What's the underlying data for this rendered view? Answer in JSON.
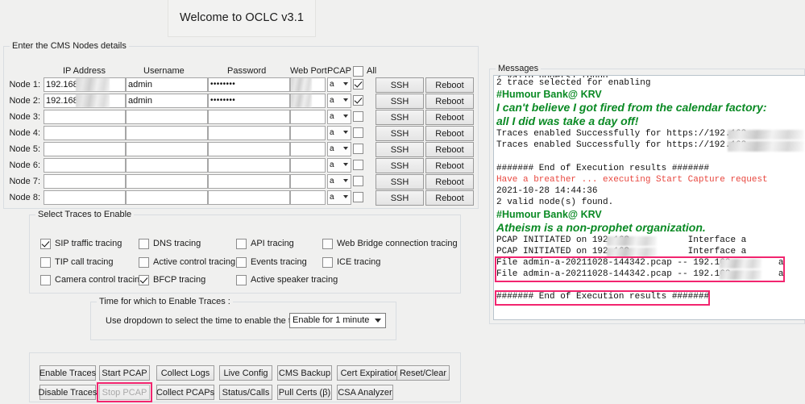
{
  "window": {
    "title": "Welcome to OCLC v3.1"
  },
  "nodes_panel": {
    "legend": "Enter the CMS Nodes details",
    "columns": {
      "ip": "IP Address",
      "username": "Username",
      "password": "Password",
      "webport": "Web Port",
      "pcap": "PCAP",
      "all": "All"
    },
    "all_checked": false,
    "rows": [
      {
        "label": "Node 1:",
        "ip": "192.168",
        "username": "admin",
        "password": "••••••••",
        "webport": "",
        "pcap_mode": "a",
        "pcap_checked": true,
        "ssh": "SSH",
        "reboot": "Reboot",
        "redacted": true
      },
      {
        "label": "Node 2:",
        "ip": "192.168",
        "username": "admin",
        "password": "••••••••",
        "webport": "",
        "pcap_mode": "a",
        "pcap_checked": true,
        "ssh": "SSH",
        "reboot": "Reboot",
        "redacted": true
      },
      {
        "label": "Node 3:",
        "ip": "",
        "username": "",
        "password": "",
        "webport": "",
        "pcap_mode": "a",
        "pcap_checked": false,
        "ssh": "SSH",
        "reboot": "Reboot",
        "redacted": false
      },
      {
        "label": "Node 4:",
        "ip": "",
        "username": "",
        "password": "",
        "webport": "",
        "pcap_mode": "a",
        "pcap_checked": false,
        "ssh": "SSH",
        "reboot": "Reboot",
        "redacted": false
      },
      {
        "label": "Node 5:",
        "ip": "",
        "username": "",
        "password": "",
        "webport": "",
        "pcap_mode": "a",
        "pcap_checked": false,
        "ssh": "SSH",
        "reboot": "Reboot",
        "redacted": false
      },
      {
        "label": "Node 6:",
        "ip": "",
        "username": "",
        "password": "",
        "webport": "",
        "pcap_mode": "a",
        "pcap_checked": false,
        "ssh": "SSH",
        "reboot": "Reboot",
        "redacted": false
      },
      {
        "label": "Node 7:",
        "ip": "",
        "username": "",
        "password": "",
        "webport": "",
        "pcap_mode": "a",
        "pcap_checked": false,
        "ssh": "SSH",
        "reboot": "Reboot",
        "redacted": false
      },
      {
        "label": "Node 8:",
        "ip": "",
        "username": "",
        "password": "",
        "webport": "",
        "pcap_mode": "a",
        "pcap_checked": false,
        "ssh": "SSH",
        "reboot": "Reboot",
        "redacted": false
      }
    ]
  },
  "traces_panel": {
    "legend": "Select Traces to Enable",
    "items": [
      {
        "label": "SIP traffic tracing",
        "checked": true,
        "col": 0,
        "row": 0
      },
      {
        "label": "DNS tracing",
        "checked": false,
        "col": 1,
        "row": 0
      },
      {
        "label": "API tracing",
        "checked": false,
        "col": 2,
        "row": 0
      },
      {
        "label": "Web Bridge connection tracing",
        "checked": false,
        "col": 3,
        "row": 0
      },
      {
        "label": "TIP call tracing",
        "checked": false,
        "col": 0,
        "row": 1
      },
      {
        "label": "Active control tracing",
        "checked": false,
        "col": 1,
        "row": 1
      },
      {
        "label": "Events tracing",
        "checked": false,
        "col": 2,
        "row": 1
      },
      {
        "label": "ICE tracing",
        "checked": false,
        "col": 3,
        "row": 1
      },
      {
        "label": "Camera control tracing",
        "checked": false,
        "col": 0,
        "row": 2
      },
      {
        "label": "BFCP tracing",
        "checked": true,
        "col": 1,
        "row": 2
      },
      {
        "label": "Active speaker tracing",
        "checked": false,
        "col": 2,
        "row": 2
      }
    ]
  },
  "time_panel": {
    "legend": "Time for which to Enable Traces :",
    "prompt": "Use dropdown to select the time to enable the traces:",
    "selected": "Enable for 1 minute"
  },
  "actions_panel": {
    "row1": [
      "Enable  Traces",
      "Start PCAP",
      "Collect  Logs",
      "Live Config",
      "CMS Backup",
      "Cert Expiration",
      "Reset/Clear"
    ],
    "row2": [
      "Disable Traces",
      "Stop PCAP",
      "Collect PCAPs",
      "Status/Calls",
      "Pull Certs (β)",
      "CSA Analyzer"
    ],
    "disabled_button": "Stop PCAP",
    "highlight_color": "#f2256f"
  },
  "messages_panel": {
    "legend": "Messages",
    "lines": [
      {
        "text": "2 valid node(s) found.",
        "style": "clipped"
      },
      {
        "text": "2 trace selected for enabling",
        "style": "mono"
      },
      {
        "text": "#Humour Bank@ KRV",
        "style": "green-heading"
      },
      {
        "text": "I can't believe I got fired from the calendar factory:",
        "style": "green-italic"
      },
      {
        "text": "all I did was take a day off!",
        "style": "green-italic"
      },
      {
        "text": "Traces enabled Successfully for https://192.168.",
        "style": "mono",
        "redacted": true
      },
      {
        "text": "Traces enabled Successfully for https://192.168.",
        "style": "mono",
        "redacted": true
      },
      {
        "text": "",
        "style": "blank"
      },
      {
        "text": "####### End of Execution results #######",
        "style": "mono"
      },
      {
        "text": "Have a breather ... executing Start Capture request",
        "style": "red"
      },
      {
        "text": "2021-10-28 14:44:36",
        "style": "mono"
      },
      {
        "text": "2 valid node(s) found.",
        "style": "mono"
      },
      {
        "text": "#Humour Bank@ KRV",
        "style": "green-heading"
      },
      {
        "text": "Atheism is a non-prophet organization.",
        "style": "green-italic"
      },
      {
        "text": "PCAP INITIATED on 192.168.          Interface a",
        "style": "mono",
        "redacted": true
      },
      {
        "text": "PCAP INITIATED on 192.168.          Interface a",
        "style": "mono",
        "redacted": true
      },
      {
        "text": "File admin-a-20211028-144342.pcap -- 192.168.        a",
        "style": "mono",
        "redacted": true,
        "highlight": "start"
      },
      {
        "text": "File admin-a-20211028-144342.pcap -- 192.168.        a",
        "style": "mono",
        "redacted": true,
        "highlight": "end"
      },
      {
        "text": "",
        "style": "blank"
      },
      {
        "text": "####### End of Execution results #######",
        "style": "mono",
        "highlight": "single"
      }
    ],
    "highlight_color": "#f2256f"
  }
}
